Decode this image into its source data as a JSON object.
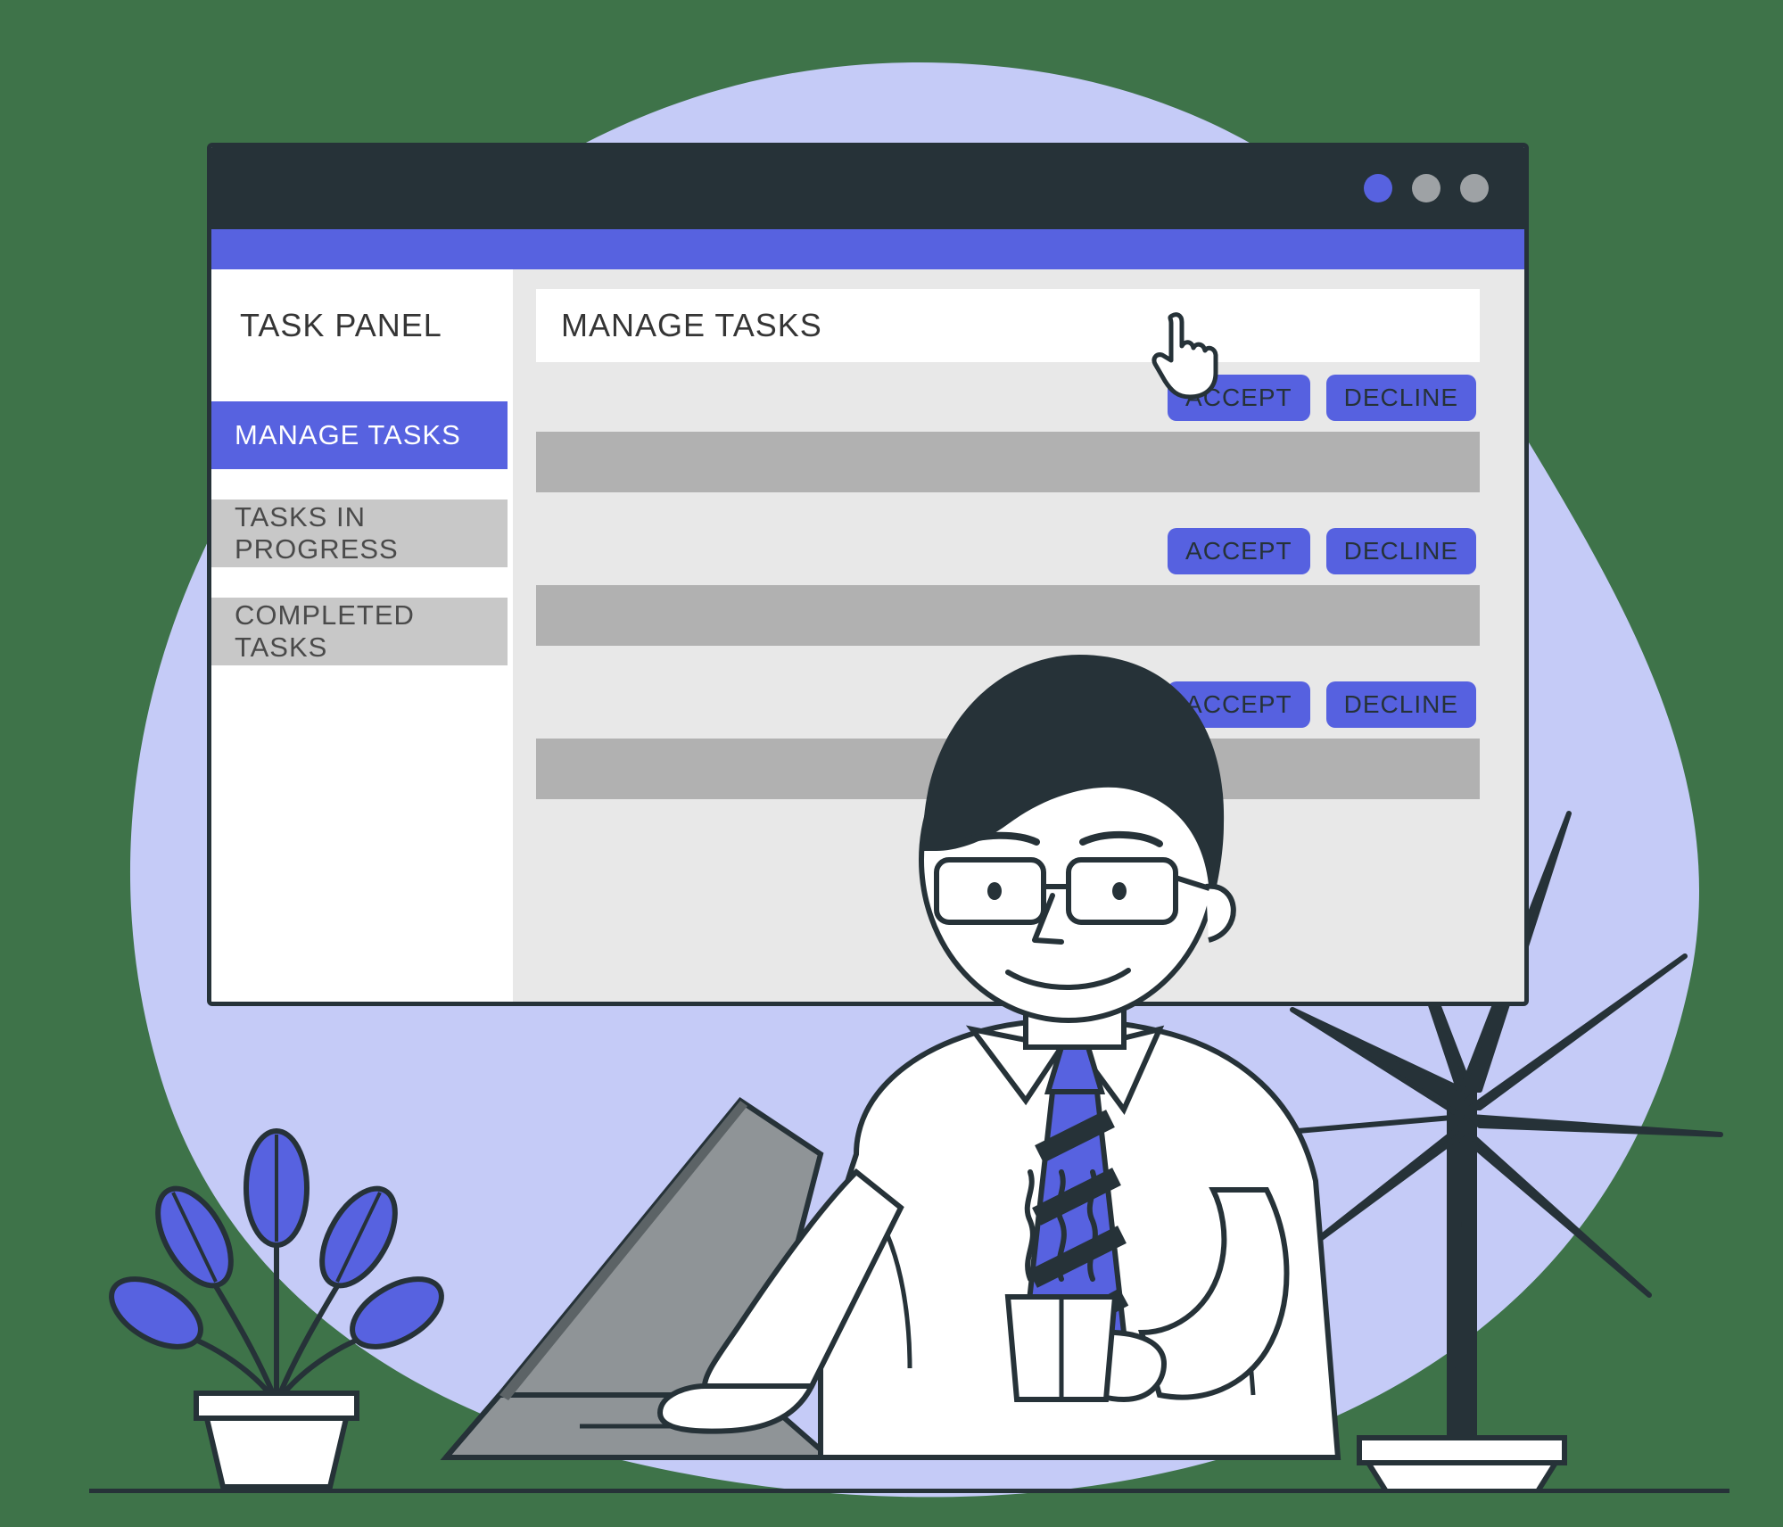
{
  "sidebar": {
    "title": "TASK PANEL",
    "items": [
      {
        "label": "MANAGE TASKS",
        "active": true
      },
      {
        "label": "TASKS IN PROGRESS",
        "active": false
      },
      {
        "label": "COMPLETED TASKS",
        "active": false
      }
    ]
  },
  "main": {
    "title": "MANAGE TASKS",
    "tasks": [
      {
        "accept_label": "ACCEPT",
        "decline_label": "DECLINE"
      },
      {
        "accept_label": "ACCEPT",
        "decline_label": "DECLINE"
      },
      {
        "accept_label": "ACCEPT",
        "decline_label": "DECLINE"
      }
    ]
  },
  "colors": {
    "primary": "#5762e0",
    "dark": "#263238",
    "background_blob": "#c5cbf7"
  }
}
